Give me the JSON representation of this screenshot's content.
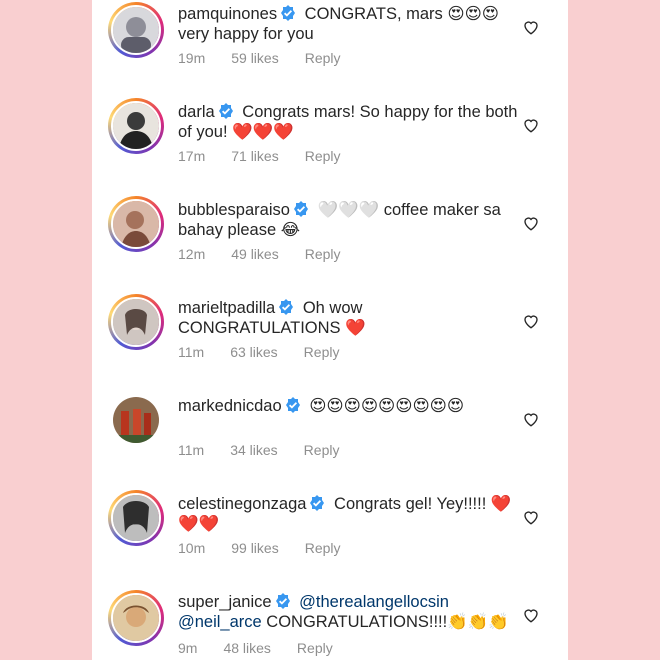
{
  "comments": [
    {
      "username": "pamquinones",
      "text": "CONGRATS, mars 😍😍😍 very happy for you",
      "time": "19m",
      "likes": "59 likes",
      "reply": "Reply",
      "avatar_color": "#9a9aa6"
    },
    {
      "username": "darla",
      "text": "Congrats mars! So happy for the both of you! ❤️❤️❤️",
      "time": "17m",
      "likes": "71 likes",
      "reply": "Reply",
      "avatar_color": "#3b3b3b"
    },
    {
      "username": "bubblesparaiso",
      "text": "🤍🤍🤍 coffee maker sa bahay please 😂",
      "time": "12m",
      "likes": "49 likes",
      "reply": "Reply",
      "avatar_color": "#8b5a48"
    },
    {
      "username": "marieltpadilla",
      "text": "Oh wow CONGRATULATIONS ❤️",
      "time": "11m",
      "likes": "63 likes",
      "reply": "Reply",
      "avatar_color": "#b8aca6"
    },
    {
      "username": "markednicdao",
      "text": "😍😍😍😍😍😍😍😍😍",
      "time": "11m",
      "likes": "34 likes",
      "reply": "Reply",
      "avatar_color": "#6e3c2e"
    },
    {
      "username": "celestinegonzaga",
      "text": "Congrats gel! Yey!!!!! ❤️❤️❤️",
      "time": "10m",
      "likes": "99 likes",
      "reply": "Reply",
      "avatar_color": "#4a4a4a"
    },
    {
      "username": "super_janice",
      "mention1": "@therealangellocsin",
      "mention2": "@neil_arce",
      "text": " CONGRATULATIONS!!!!👏👏👏",
      "time": "9m",
      "likes": "48 likes",
      "reply": "Reply",
      "avatar_color": "#c49a5a"
    }
  ],
  "colors": {
    "background": "#f9cfd0",
    "panel": "#ffffff",
    "verified": "#3897f0",
    "meta": "#8e8e8e"
  }
}
